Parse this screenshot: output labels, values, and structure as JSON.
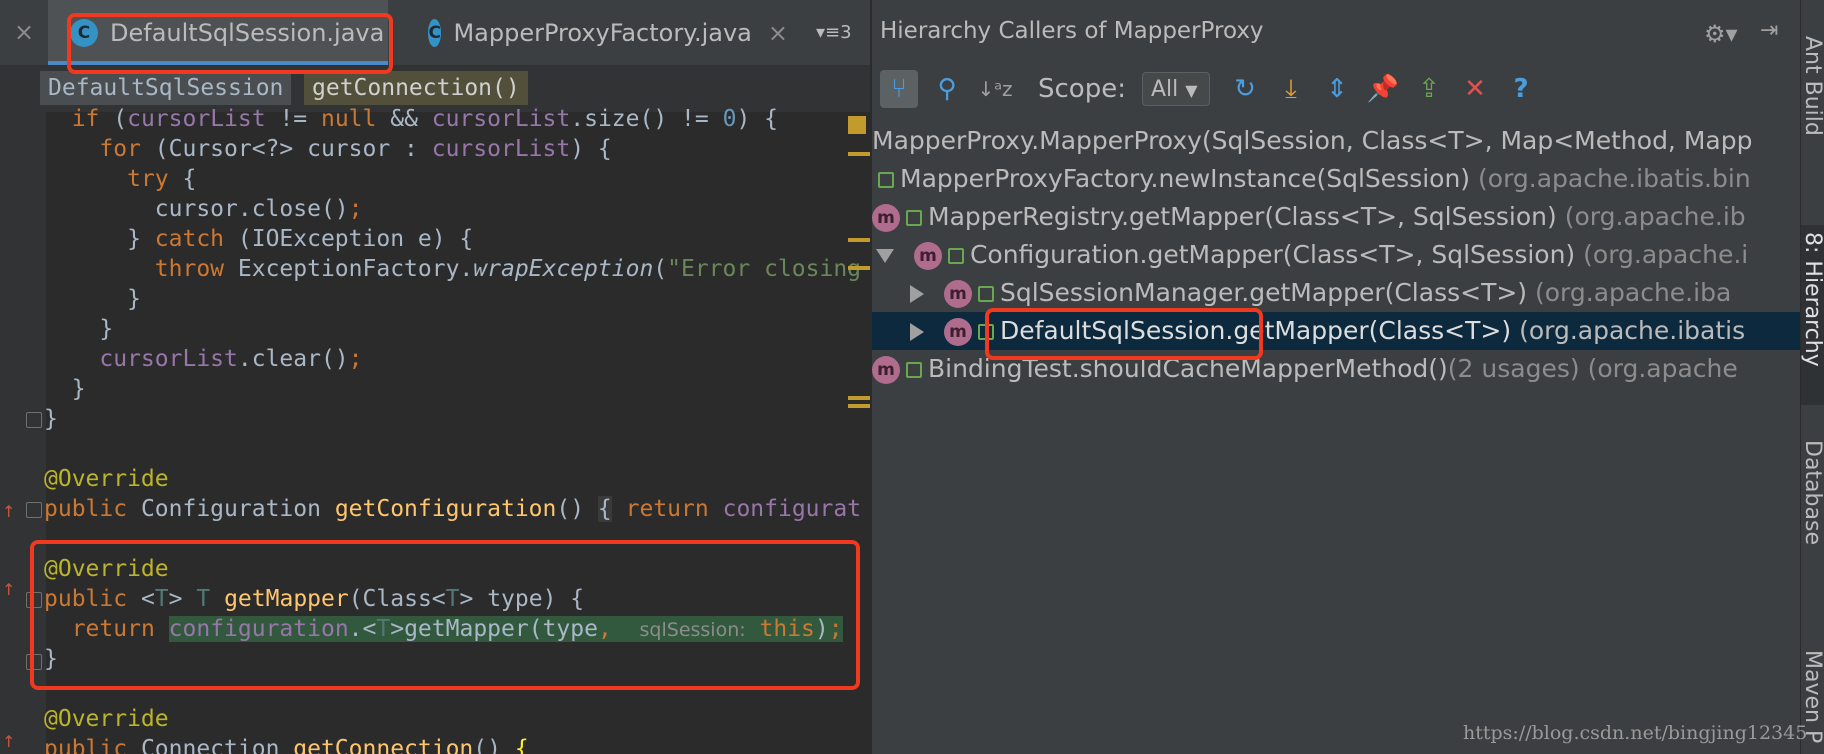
{
  "editor": {
    "tabs": [
      {
        "label": "DefaultSqlSession.java",
        "icon": "class-icon",
        "active": true
      },
      {
        "label": "MapperProxyFactory.java",
        "icon": "class-icon",
        "active": false
      }
    ],
    "tab_overflow": "3",
    "breadcrumbs": [
      "DefaultSqlSession",
      "getConnection()"
    ],
    "inlay_hint": "sqlSession:"
  },
  "hierarchy": {
    "title": "Hierarchy Callers of MapperProxy",
    "scope_label": "Scope:",
    "scope_value": "All",
    "rows": [
      {
        "name": "MapperProxy.MapperProxy(SqlSession, Class<T>, Map<Method, Mapp",
        "pkg": ""
      },
      {
        "name": "MapperProxyFactory.newInstance(SqlSession)",
        "pkg": "(org.apache.ibatis.bin"
      },
      {
        "name": "MapperRegistry.getMapper(Class<T>, SqlSession)",
        "pkg": "(org.apache.ib"
      },
      {
        "name": "Configuration.getMapper(Class<T>, SqlSession)",
        "pkg": "(org.apache.i"
      },
      {
        "name": "SqlSessionManager.getMapper(Class<T>)",
        "pkg": "(org.apache.iba"
      },
      {
        "name": "DefaultSqlSession.getMapper(Class<T>)",
        "pkg": "(org.apache.ibatis"
      },
      {
        "name": "BindingTest.shouldCacheMapperMethod()",
        "usages": "(2 usages)",
        "pkg": "(org.apache"
      }
    ]
  },
  "side_tabs": [
    "Ant Build",
    "8: Hierarchy",
    "Database",
    "Maven P"
  ],
  "watermark": "https://blog.csdn.net/bingjing12345",
  "colors": {
    "highlight_box": "#f0391e",
    "selection": "#0d293e",
    "accent": "#4a88c7"
  }
}
